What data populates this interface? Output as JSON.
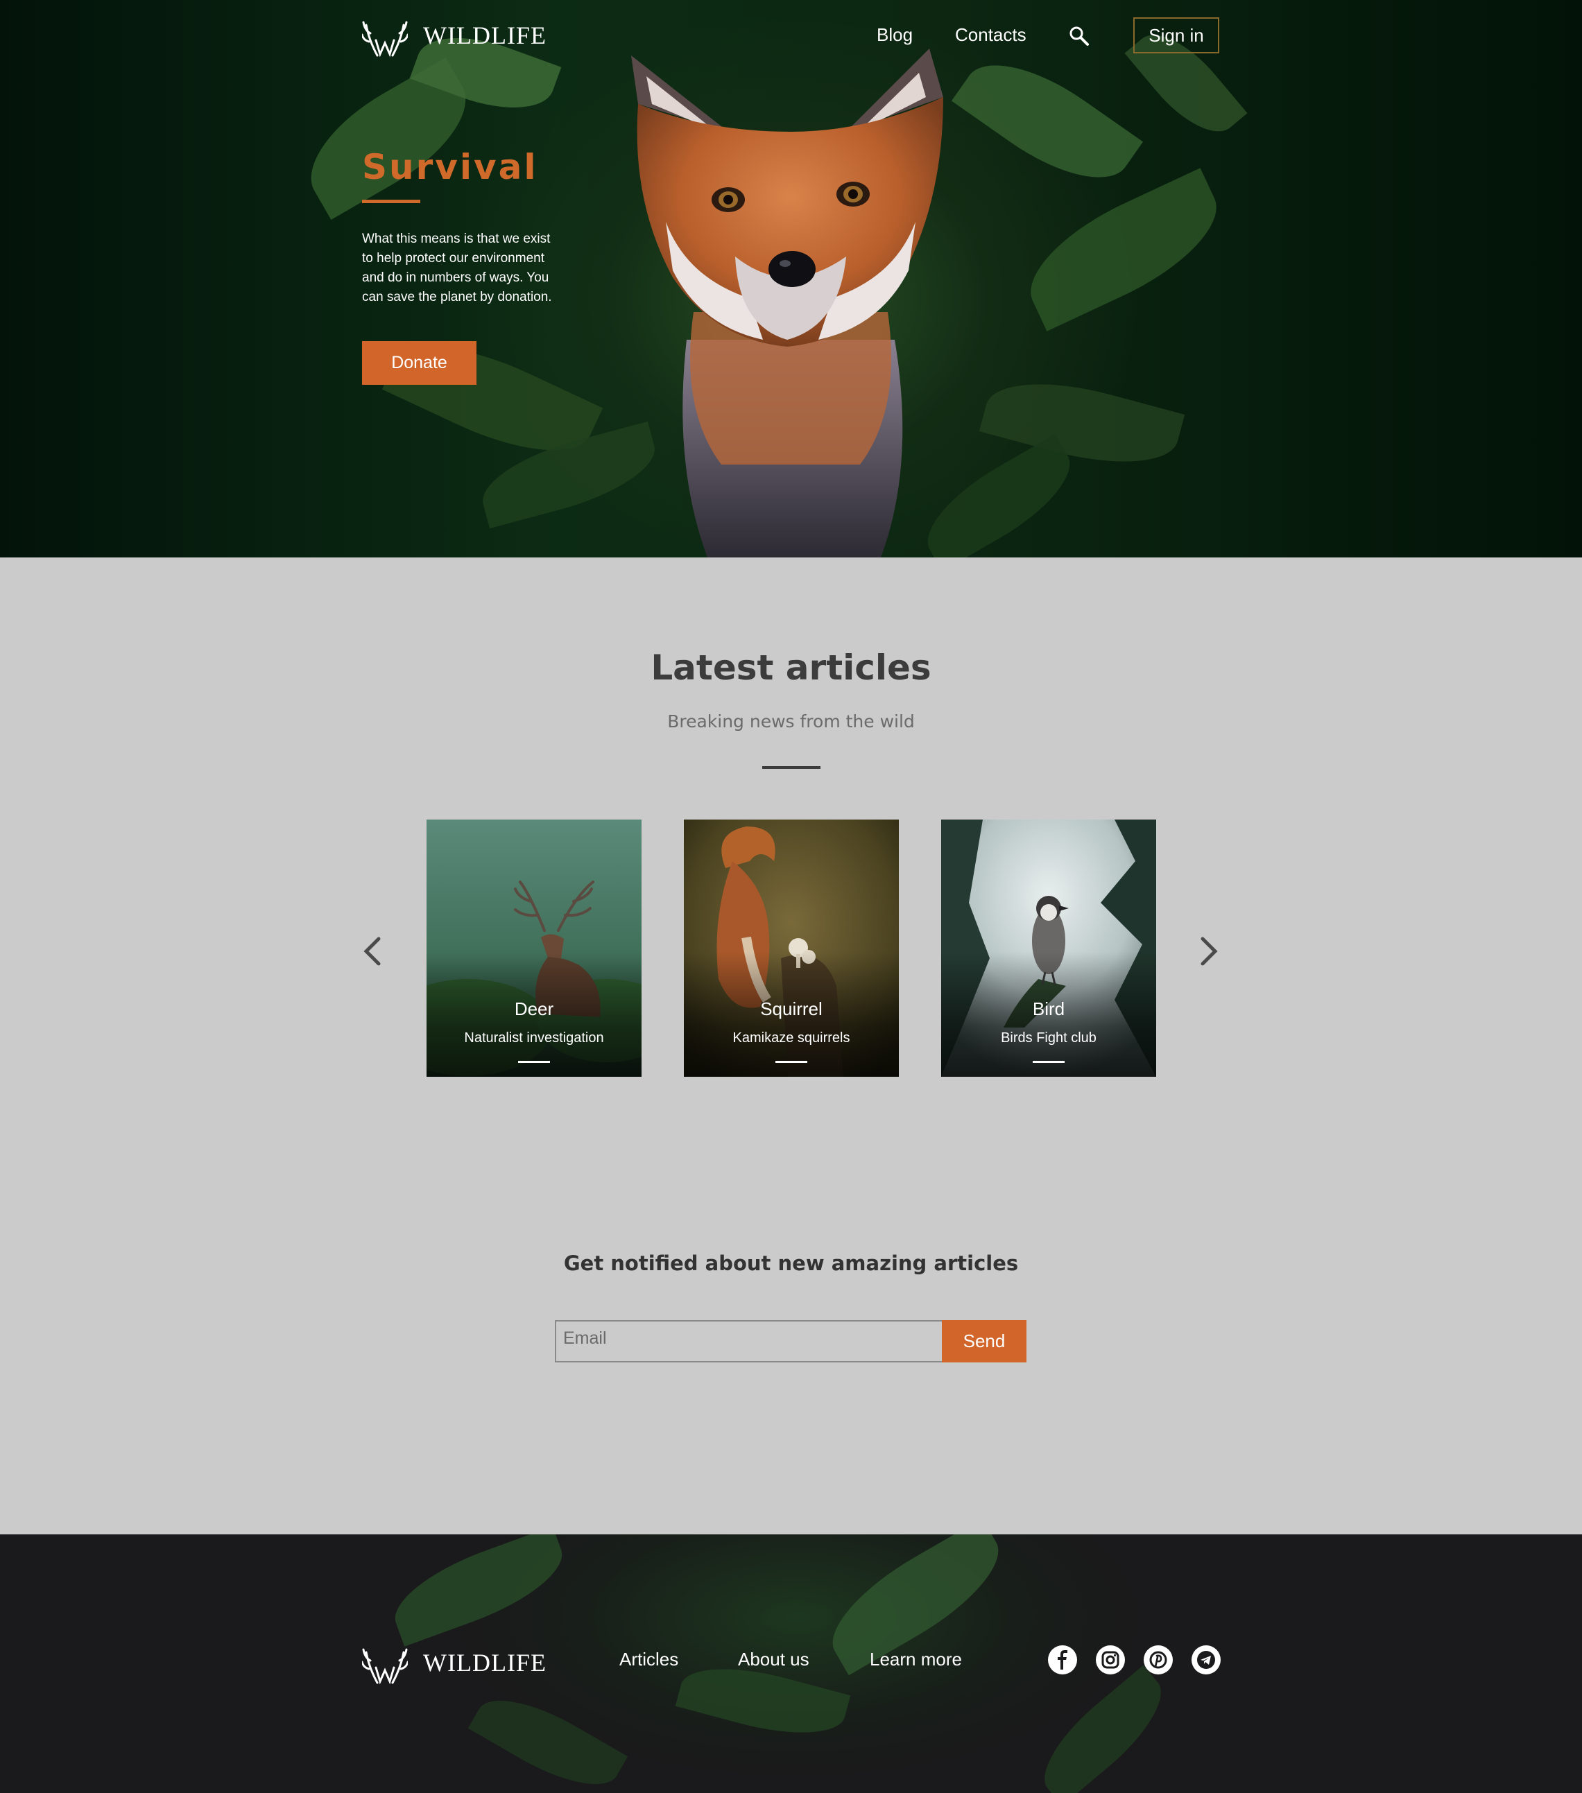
{
  "brand": {
    "name": "WILDLIFE"
  },
  "nav": {
    "blog": "Blog",
    "contacts": "Contacts",
    "sign_in": "Sign in"
  },
  "hero": {
    "title": "Survival",
    "text": "What this means is that we exist to help protect our environment and do in numbers of ways. You can save the planet by donation.",
    "donate": "Donate"
  },
  "articles": {
    "title": "Latest articles",
    "subtitle": "Breaking news from the wild",
    "cards": [
      {
        "title": "Deer",
        "subtitle": "Naturalist investigation"
      },
      {
        "title": "Squirrel",
        "subtitle": "Kamikaze squirrels"
      },
      {
        "title": "Bird",
        "subtitle": "Birds Fight club"
      }
    ]
  },
  "newsletter": {
    "title": "Get notified about new amazing articles",
    "email_placeholder": "Email",
    "send": "Send"
  },
  "footer": {
    "links": [
      "Articles",
      "About us",
      "Learn more"
    ],
    "social_icons": [
      "facebook-icon",
      "instagram-icon",
      "pinterest-icon",
      "telegram-icon"
    ]
  },
  "colors": {
    "accent": "#d2652a",
    "hero_title": "#d06a2a",
    "page_background": "#cbcbcb",
    "footer_background": "#1a191b"
  }
}
